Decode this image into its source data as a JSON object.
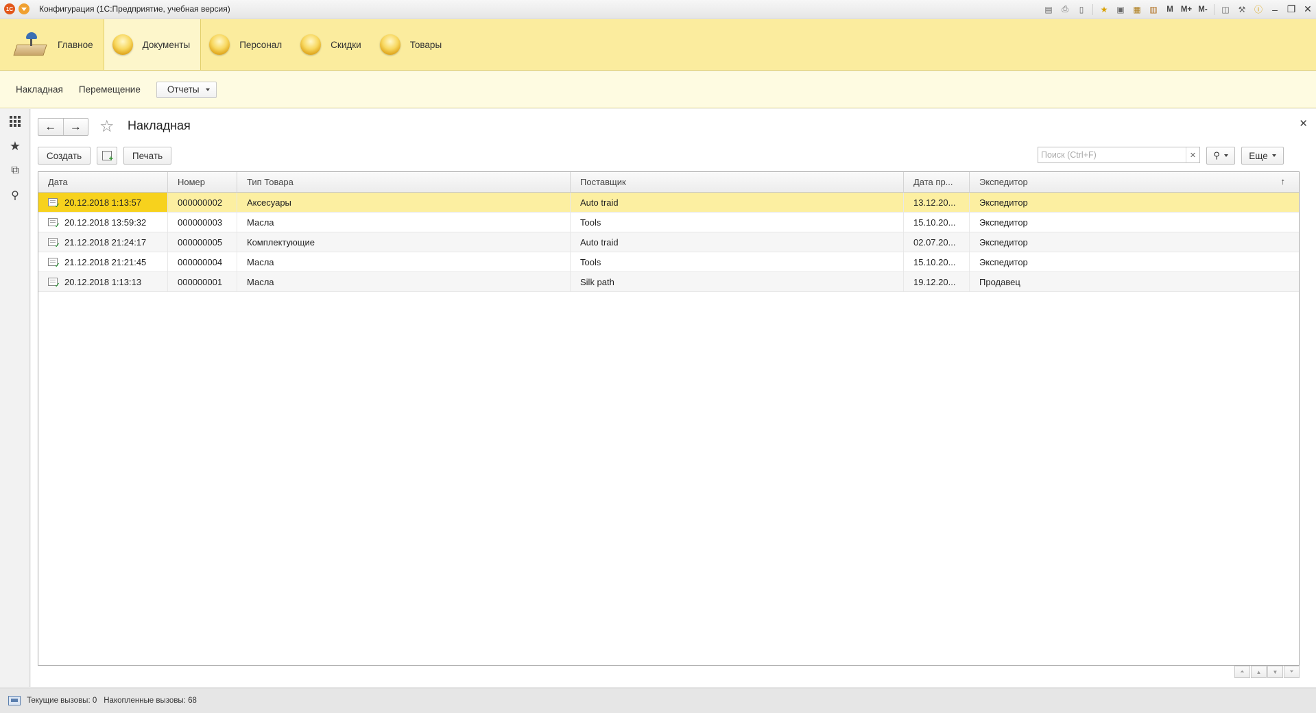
{
  "window": {
    "logo": "1С",
    "title": "Конфигурация  (1С:Предприятие, учебная версия)",
    "toolbar": {
      "m_label": "M",
      "mplus_label": "M+",
      "mminus_label": "M-"
    }
  },
  "sections": [
    {
      "label": "Главное",
      "icon": "home-icon"
    },
    {
      "label": "Документы",
      "icon": "section-orb-icon"
    },
    {
      "label": "Персонал",
      "icon": "section-orb-icon"
    },
    {
      "label": "Скидки",
      "icon": "section-orb-icon"
    },
    {
      "label": "Товары",
      "icon": "section-orb-icon"
    }
  ],
  "active_section": "Документы",
  "command_bar": {
    "links": [
      "Накладная",
      "Перемещение"
    ],
    "reports_label": "Отчеты"
  },
  "form": {
    "title": "Накладная",
    "create_label": "Создать",
    "print_label": "Печать",
    "search_placeholder": "Поиск (Ctrl+F)",
    "more_label": "Еще"
  },
  "table": {
    "columns": [
      "Дата",
      "Номер",
      "Тип Товара",
      "Поставщик",
      "Дата пр...",
      "Экспедитор"
    ],
    "rows": [
      {
        "date": "20.12.2018 1:13:57",
        "number": "000000002",
        "type": "Аксесуары",
        "supplier": "Auto traid",
        "date2": "13.12.20...",
        "forwarder": "Экспедитор",
        "selected": true
      },
      {
        "date": "20.12.2018 13:59:32",
        "number": "000000003",
        "type": "Масла",
        "supplier": "Tools",
        "date2": "15.10.20...",
        "forwarder": "Экспедитор",
        "selected": false
      },
      {
        "date": "21.12.2018 21:24:17",
        "number": "000000005",
        "type": "Комплектующие",
        "supplier": "Auto traid",
        "date2": "02.07.20...",
        "forwarder": "Экспедитор",
        "selected": false
      },
      {
        "date": "21.12.2018 21:21:45",
        "number": "000000004",
        "type": "Масла",
        "supplier": "Tools",
        "date2": "15.10.20...",
        "forwarder": "Экспедитор",
        "selected": false
      },
      {
        "date": "20.12.2018 1:13:13",
        "number": "000000001",
        "type": "Масла",
        "supplier": "Silk path",
        "date2": "19.12.20...",
        "forwarder": "Продавец",
        "selected": false
      }
    ]
  },
  "status_bar": {
    "current_calls": "Текущие вызовы: 0",
    "accumulated_calls": "Накопленные вызовы: 68"
  },
  "colors": {
    "sections_bg": "#fbec9e",
    "command_bar_bg": "#fefbe1",
    "selected_row": "#fcefa1",
    "selected_cell": "#f7d21d"
  }
}
